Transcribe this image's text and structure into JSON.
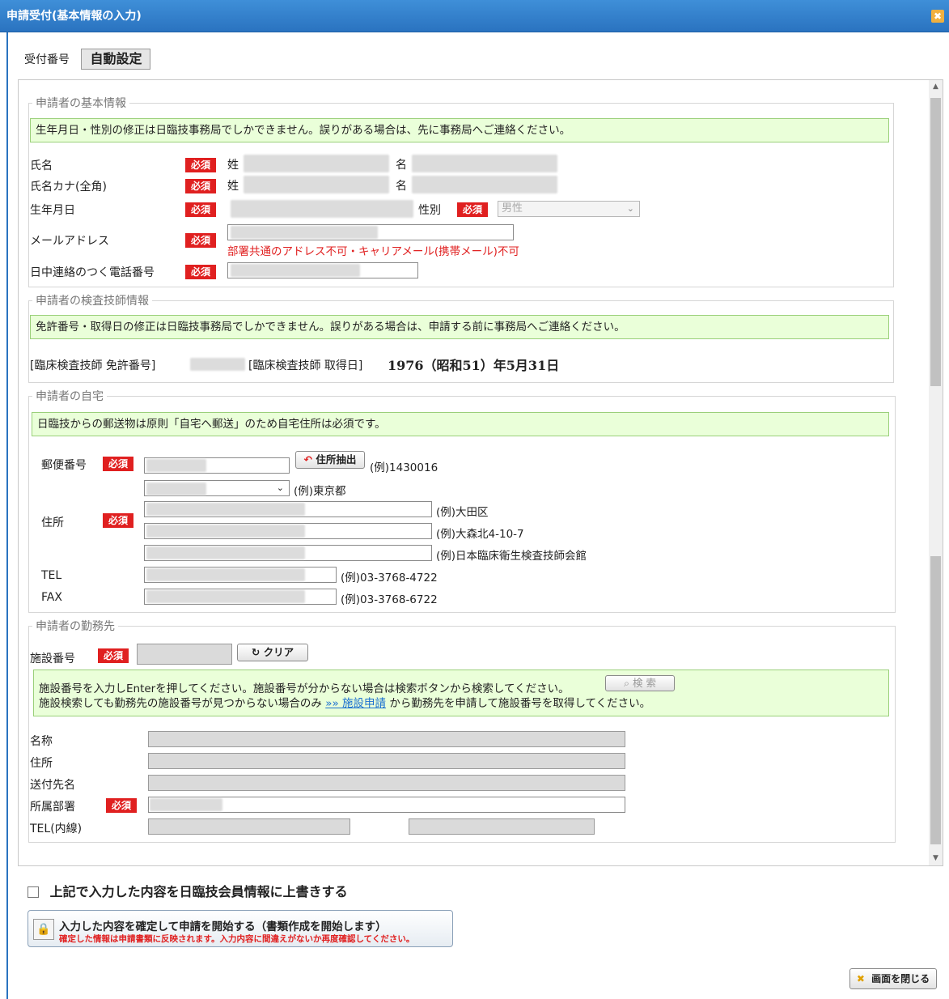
{
  "window": {
    "title": "申請受付(基本情報の入力)"
  },
  "receipt": {
    "label": "受付番号",
    "value": "自動設定"
  },
  "required_badge": "必須",
  "applicant_basic": {
    "legend": "申請者の基本情報",
    "notice": "生年月日・性別の修正は日臨技事務局でしかできません。誤りがある場合は、先に事務局へご連絡ください。",
    "name_label": "氏名",
    "kana_label": "氏名カナ(全角)",
    "last_prefix": "姓",
    "first_prefix": "名",
    "birth_label": "生年月日",
    "gender_label": "性別",
    "gender_value": "男性",
    "email_label": "メールアドレス",
    "email_warning": "部署共通のアドレス不可・キャリアメール(携帯メール)不可",
    "phone_label": "日中連絡のつく電話番号"
  },
  "tech_info": {
    "legend": "申請者の検査技師情報",
    "notice": "免許番号・取得日の修正は日臨技事務局でしかできません。誤りがある場合は、申請する前に事務局へご連絡ください。",
    "license_label": "[臨床検査技師 免許番号]",
    "acquired_label": "[臨床検査技師 取得日]",
    "acquired_value": "1976（昭和51）年5月31日"
  },
  "home": {
    "legend": "申請者の自宅",
    "notice": "日臨技からの郵送物は原則「自宅へ郵送」のため自宅住所は必須です。",
    "postal_label": "郵便番号",
    "address_extract_button": "住所抽出",
    "postal_example": "(例)1430016",
    "pref_example": "(例)東京都",
    "address_label": "住所",
    "addr_example1": "(例)大田区",
    "addr_example2": "(例)大森北4-10-7",
    "addr_example3": "(例)日本臨床衛生検査技師会館",
    "tel_label": "TEL",
    "tel_example": "(例)03-3768-4722",
    "fax_label": "FAX",
    "fax_example": "(例)03-3768-6722"
  },
  "workplace": {
    "legend": "申請者の勤務先",
    "facility_label": "施設番号",
    "clear_button": "クリア",
    "notice_line1": "施設番号を入力しEnterを押してください。施設番号が分からない場合は検索ボタンから検索してください。",
    "search_button": "検 索",
    "notice_line2_a": "施設検索しても勤務先の施設番号が見つからない場合のみ",
    "notice_link": "»» 施設申請",
    "notice_line2_b": "から勤務先を申請して施設番号を取得してください。",
    "name_label": "名称",
    "address_label": "住所",
    "recipient_label": "送付先名",
    "dept_label": "所属部署",
    "tel_label": "TEL(内線)"
  },
  "overwrite_checkbox": "上記で入力した内容を日臨技会員情報に上書きする",
  "confirm": {
    "line1": "入力した内容を確定して申請を開始する（書類作成を開始します）",
    "line2": "確定した情報は申請書類に反映されます。入力内容に間違えがないか再度確認してください。"
  },
  "close_button": "画面を閉じる"
}
